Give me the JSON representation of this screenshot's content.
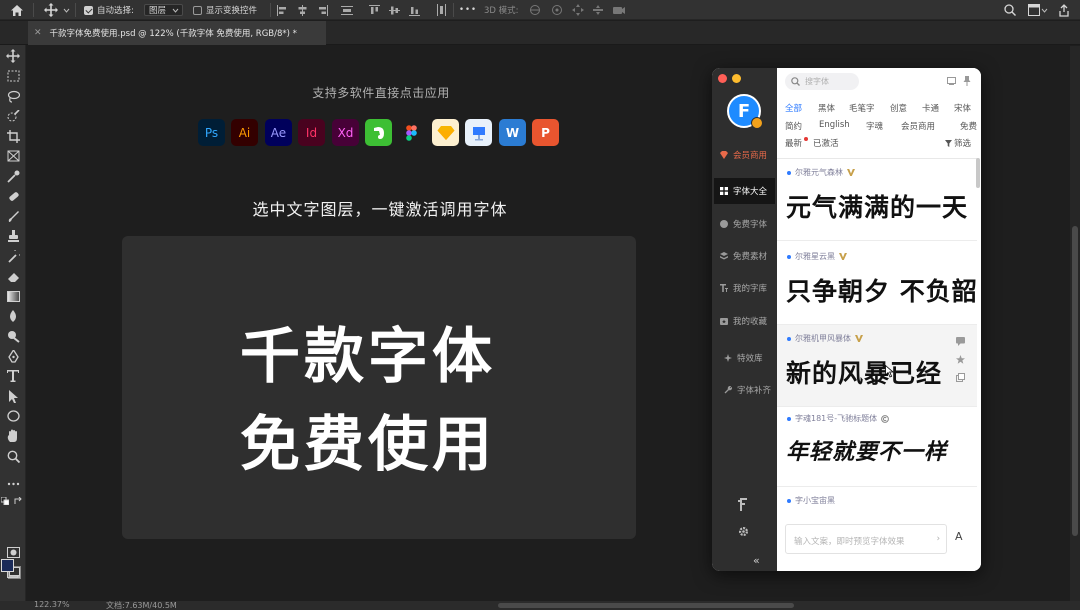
{
  "options_bar": {
    "auto_select_label": "自动选择:",
    "auto_select_value": "图层",
    "show_transform_label": "显示变换控件",
    "mode_3d_label": "3D 模式:",
    "more": "•••"
  },
  "document": {
    "tab_title": "千款字体免费使用.psd @ 122% (千款字体 免费使用, RGB/8*) *",
    "close": "✕"
  },
  "status": {
    "zoom": "122.37%",
    "doc_size": "文档:7.63M/40.5M"
  },
  "artwork": {
    "tagline": "支持多软件直接点击应用",
    "headline": "选中文字图层，一键激活调用字体",
    "demo_line1": "千款字体",
    "demo_line2": "免费使用",
    "apps": [
      {
        "label": "Ps",
        "icon": "photoshop-icon",
        "bg": "#001e36",
        "fg": "#31a8ff"
      },
      {
        "label": "Ai",
        "icon": "illustrator-icon",
        "bg": "#330000",
        "fg": "#ff9a00"
      },
      {
        "label": "Ae",
        "icon": "after-effects-icon",
        "bg": "#00005b",
        "fg": "#9999ff"
      },
      {
        "label": "Id",
        "icon": "indesign-icon",
        "bg": "#49021f",
        "fg": "#ff3366"
      },
      {
        "label": "Xd",
        "icon": "xd-icon",
        "bg": "#470137",
        "fg": "#ff61f6"
      },
      {
        "label": "",
        "icon": "evernote-icon",
        "bg": "#3dbf34",
        "fg": "#ffffff"
      },
      {
        "label": "",
        "icon": "figma-icon",
        "bg": "#1e1e1e",
        "fg": "#ffffff"
      },
      {
        "label": "",
        "icon": "sketch-icon",
        "bg": "#fdf0d0",
        "fg": "#f7b500"
      },
      {
        "label": "",
        "icon": "keynote-icon",
        "bg": "#e8f1fb",
        "fg": "#2f7bff"
      },
      {
        "label": "W",
        "icon": "word-icon",
        "bg": "#2b7cd3",
        "fg": "#ffffff"
      },
      {
        "label": "P",
        "icon": "powerpoint-icon",
        "bg": "#e8552f",
        "fg": "#ffffff"
      }
    ]
  },
  "font_panel": {
    "logo_letter": "F",
    "nav": [
      {
        "label": "会员商用",
        "icon": "vip-icon"
      },
      {
        "label": "字体大全",
        "icon": "grid-icon"
      },
      {
        "label": "免费字体",
        "icon": "free-icon"
      },
      {
        "label": "免费素材",
        "icon": "material-icon"
      },
      {
        "label": "我的字库",
        "icon": "my-fonts-icon"
      },
      {
        "label": "我的收藏",
        "icon": "favorites-icon"
      },
      {
        "label": "特效库",
        "icon": "effects-icon"
      },
      {
        "label": "字体补齐",
        "icon": "wrench-icon"
      }
    ],
    "collapse": "«",
    "search_placeholder": "搜字体",
    "categories_row1": [
      "全部",
      "黑体",
      "毛笔字",
      "创意",
      "卡通",
      "宋体"
    ],
    "categories_row2": [
      "简约",
      "English",
      "字魂",
      "会员商用",
      "免费"
    ],
    "row3_latest": "最新",
    "row3_activated": "已激活",
    "row3_filter": "筛选",
    "fonts": [
      {
        "name": "尔雅元气森林",
        "sample": "元气满满的一天"
      },
      {
        "name": "尔雅星云黑",
        "sample": "只争朝夕 不负韶华"
      },
      {
        "name": "尔雅机甲风暴体",
        "sample": "新的风暴已经"
      },
      {
        "name": "字魂181号-飞驰标题体",
        "sample": "年轻就要不一样"
      },
      {
        "name": "字小宝宙黑",
        "sample": ""
      }
    ],
    "input_placeholder": "输入文案，即时预览字体效果",
    "input_arrow": "›",
    "a_button": "A"
  }
}
